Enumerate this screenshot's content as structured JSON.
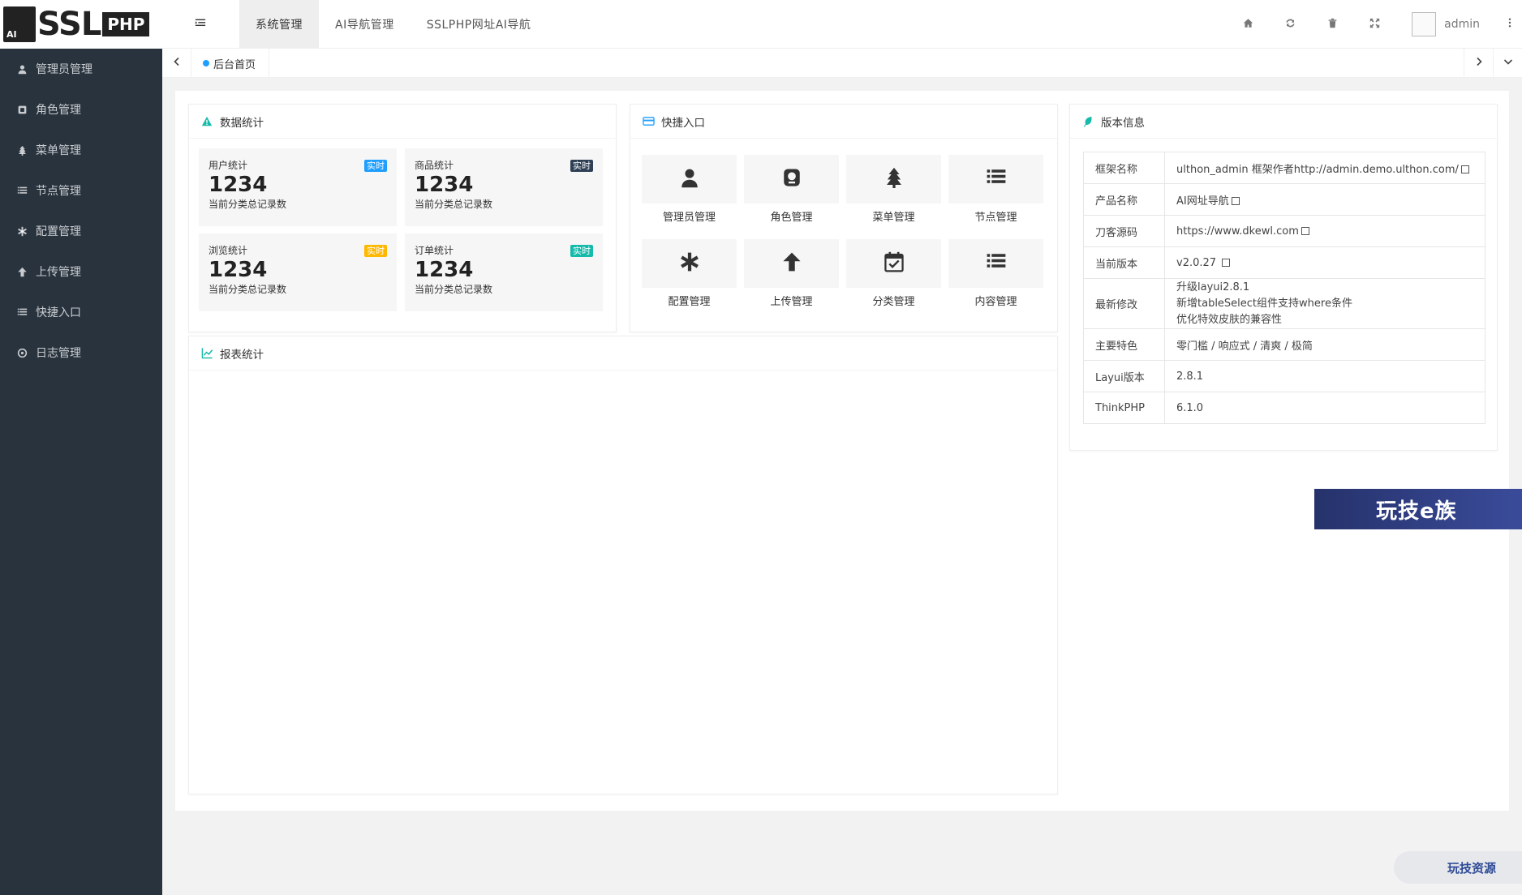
{
  "brand": {
    "logo_ssl": "SSL",
    "logo_php": "PHP",
    "logo_ai": "AI"
  },
  "sidebar": {
    "items": [
      {
        "label": "管理员管理",
        "icon": "user-icon"
      },
      {
        "label": "角色管理",
        "icon": "role-icon"
      },
      {
        "label": "菜单管理",
        "icon": "tree-icon"
      },
      {
        "label": "节点管理",
        "icon": "list-icon"
      },
      {
        "label": "配置管理",
        "icon": "asterisk-icon"
      },
      {
        "label": "上传管理",
        "icon": "arrow-up-icon"
      },
      {
        "label": "快捷入口",
        "icon": "list-icon"
      },
      {
        "label": "日志管理",
        "icon": "log-icon"
      }
    ]
  },
  "header": {
    "nav": [
      "系统管理",
      "AI导航管理",
      "SSLPHP网址AI导航"
    ],
    "active_nav": 0,
    "username": "admin"
  },
  "tabs": {
    "home": "后台首页"
  },
  "stats": {
    "title": "数据统计",
    "items": [
      {
        "title": "用户统计",
        "badge": "实时",
        "badge_color": "#1e9fff",
        "value": "1234",
        "desc": "当前分类总记录数"
      },
      {
        "title": "商品统计",
        "badge": "实时",
        "badge_color": "#2f4056",
        "value": "1234",
        "desc": "当前分类总记录数"
      },
      {
        "title": "浏览统计",
        "badge": "实时",
        "badge_color": "#ffb800",
        "value": "1234",
        "desc": "当前分类总记录数"
      },
      {
        "title": "订单统计",
        "badge": "实时",
        "badge_color": "#16baaa",
        "value": "1234",
        "desc": "当前分类总记录数"
      }
    ]
  },
  "quick": {
    "title": "快捷入口",
    "items": [
      {
        "label": "管理员管理",
        "icon": "user-icon"
      },
      {
        "label": "角色管理",
        "icon": "role-icon"
      },
      {
        "label": "菜单管理",
        "icon": "tree-icon"
      },
      {
        "label": "节点管理",
        "icon": "list-icon"
      },
      {
        "label": "配置管理",
        "icon": "asterisk-icon"
      },
      {
        "label": "上传管理",
        "icon": "arrow-up-icon"
      },
      {
        "label": "分类管理",
        "icon": "calendar-check-icon"
      },
      {
        "label": "内容管理",
        "icon": "list-icon"
      }
    ]
  },
  "report": {
    "title": "报表统计"
  },
  "version": {
    "title": "版本信息",
    "rows": [
      {
        "key": "框架名称",
        "value": "ulthon_admin 框架作者http://admin.demo.ulthon.com/"
      },
      {
        "key": "产品名称",
        "value": "AI网址导航"
      },
      {
        "key": "刀客源码",
        "value": "https://www.dkewl.com"
      },
      {
        "key": "当前版本",
        "value": "v2.0.27"
      },
      {
        "key": "最新修改",
        "lines": [
          "升级layui2.8.1",
          "新增tableSelect组件支持where条件",
          "优化特效皮肤的兼容性"
        ]
      },
      {
        "key": "主要特色",
        "value": "零门槛 / 响应式 / 清爽 / 极简"
      },
      {
        "key": "Layui版本",
        "value": "2.8.1"
      },
      {
        "key": "ThinkPHP",
        "value": "6.1.0"
      }
    ]
  },
  "watermarks": {
    "banner": "玩技e族",
    "corner": "玩技资源"
  },
  "colors": {
    "sidebar_bg": "#28333e",
    "accent": "#1e9fff",
    "teal": "#16baaa",
    "amber": "#ffb800"
  }
}
